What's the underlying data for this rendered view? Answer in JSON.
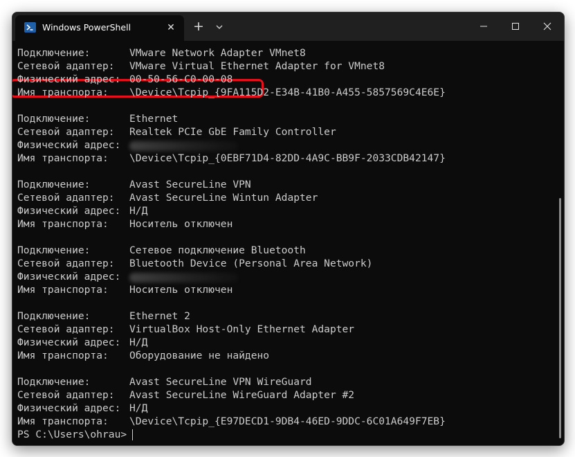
{
  "window": {
    "tab_title": "Windows PowerShell",
    "tab_icon": "powershell-icon",
    "close_tab_symbol": "✕",
    "new_tab_symbol": "+",
    "dropdown_icon": "chevron-down-icon",
    "controls": [
      "minimize-icon",
      "maximize-icon",
      "close-icon"
    ]
  },
  "terminal": {
    "lines": [
      {
        "label": "Подключение:",
        "value": "VMware Network Adapter VMnet8"
      },
      {
        "label": "Сетевой адаптер:",
        "value": "VMware Virtual Ethernet Adapter for VMnet8"
      },
      {
        "label": "Физический адрес:",
        "value": "00-50-56-C0-00-08",
        "highlighted": true
      },
      {
        "label": "Имя транспорта:",
        "value": "\\Device\\Tcpip_{9FA115D2-E34B-41B0-A455-5857569C4E6E}"
      },
      {
        "label": "",
        "value": ""
      },
      {
        "label": "Подключение:",
        "value": "Ethernet"
      },
      {
        "label": "Сетевой адаптер:",
        "value": "Realtek PCIe GbE Family Controller"
      },
      {
        "label": "Физический адрес:",
        "value": "",
        "redacted": true
      },
      {
        "label": "Имя транспорта:",
        "value": "\\Device\\Tcpip_{0EBF71D4-82DD-4A9C-BB9F-2033CDB42147}"
      },
      {
        "label": "",
        "value": ""
      },
      {
        "label": "Подключение:",
        "value": "Avast SecureLine VPN"
      },
      {
        "label": "Сетевой адаптер:",
        "value": "Avast SecureLine Wintun Adapter"
      },
      {
        "label": "Физический адрес:",
        "value": "Н/Д"
      },
      {
        "label": "Имя транспорта:",
        "value": "Носитель отключен"
      },
      {
        "label": "",
        "value": ""
      },
      {
        "label": "Подключение:",
        "value": "Сетевое подключение Bluetooth"
      },
      {
        "label": "Сетевой адаптер:",
        "value": "Bluetooth Device (Personal Area Network)"
      },
      {
        "label": "Физический адрес:",
        "value": "",
        "redacted": true
      },
      {
        "label": "Имя транспорта:",
        "value": "Носитель отключен"
      },
      {
        "label": "",
        "value": ""
      },
      {
        "label": "Подключение:",
        "value": "Ethernet 2"
      },
      {
        "label": "Сетевой адаптер:",
        "value": "VirtualBox Host-Only Ethernet Adapter"
      },
      {
        "label": "Физический адрес:",
        "value": "Н/Д"
      },
      {
        "label": "Имя транспорта:",
        "value": "Оборудование не найдено"
      },
      {
        "label": "",
        "value": ""
      },
      {
        "label": "Подключение:",
        "value": "Avast SecureLine VPN WireGuard"
      },
      {
        "label": "Сетевой адаптер:",
        "value": "Avast SecureLine WireGuard Adapter #2"
      },
      {
        "label": "Физический адрес:",
        "value": "Н/Д"
      },
      {
        "label": "Имя транспорта:",
        "value": "\\Device\\Tcpip_{E97DECD1-9DB4-46ED-9DDC-6C01A649F7EB}"
      }
    ],
    "prompt": "PS C:\\Users\\ohrau>"
  },
  "colors": {
    "background": "#0c0c0c",
    "text": "#cccccc",
    "titlebar": "#202020",
    "highlight_border": "#e8101a",
    "tab_icon": "#1f5fa8"
  }
}
